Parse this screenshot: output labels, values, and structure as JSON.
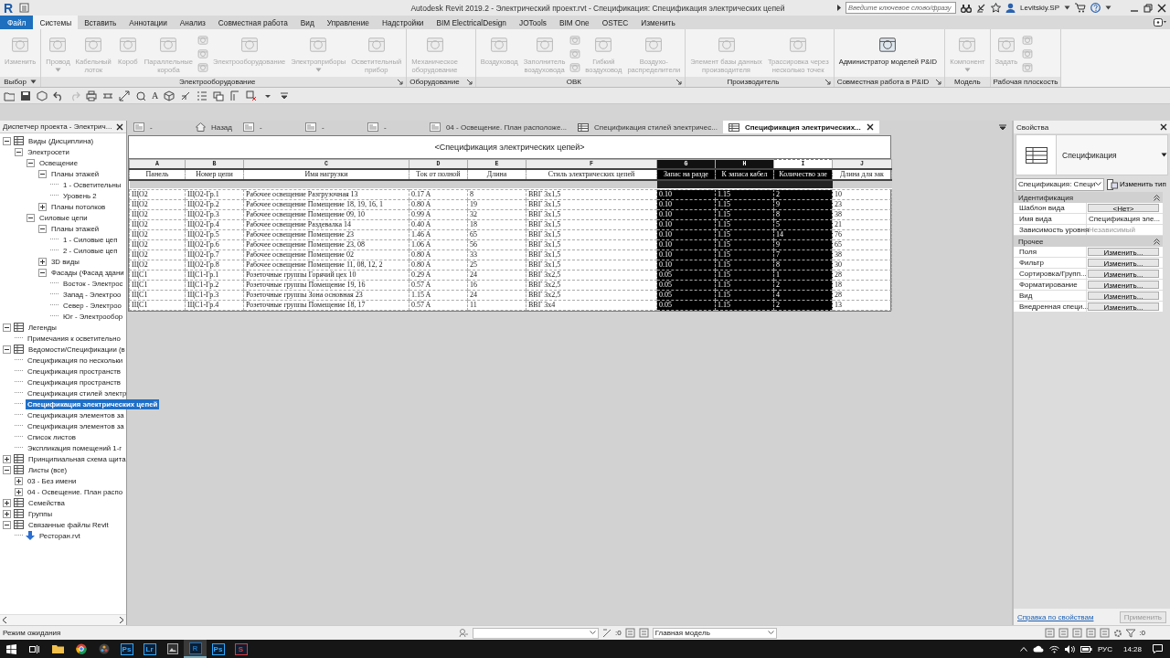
{
  "window": {
    "logo": "R",
    "title": "Autodesk Revit 2019.2 - Электрический проект.rvt - Спецификация: Спецификация электрических цепей",
    "search_placeholder": "Введите ключевое слово/фразу",
    "user": "Levitskiy.SP"
  },
  "menu_tabs": [
    {
      "label": "Файл",
      "kind": "file",
      "selected": false
    },
    {
      "label": "Системы",
      "kind": "tab",
      "selected": true
    },
    {
      "label": "Вставить",
      "kind": "tab",
      "selected": false
    },
    {
      "label": "Аннотации",
      "kind": "tab",
      "selected": false
    },
    {
      "label": "Анализ",
      "kind": "tab",
      "selected": false
    },
    {
      "label": "Совместная работа",
      "kind": "tab",
      "selected": false
    },
    {
      "label": "Вид",
      "kind": "tab",
      "selected": false
    },
    {
      "label": "Управление",
      "kind": "tab",
      "selected": false
    },
    {
      "label": "Надстройки",
      "kind": "tab",
      "selected": false
    },
    {
      "label": "BIM ElectricalDesign",
      "kind": "tab",
      "selected": false
    },
    {
      "label": "JOTools",
      "kind": "tab",
      "selected": false
    },
    {
      "label": "BIM One",
      "kind": "tab",
      "selected": false
    },
    {
      "label": "OSTEC",
      "kind": "tab",
      "selected": false
    },
    {
      "label": "Изменить",
      "kind": "tab",
      "selected": false
    }
  ],
  "ribbon": {
    "panels": [
      {
        "title": "Выбор",
        "menu": true,
        "launcher": false,
        "buttons": [
          {
            "kind": "large",
            "label": "Изменить",
            "disabled": true,
            "dropdown": false
          }
        ]
      },
      {
        "title": "Электрооборудование",
        "menu": false,
        "launcher": true,
        "buttons": [
          {
            "kind": "large",
            "label": "Провод",
            "disabled": true,
            "dropdown": true
          },
          {
            "kind": "large",
            "label": "Кабельный\nлоток",
            "disabled": true,
            "dropdown": false
          },
          {
            "kind": "large",
            "label": "Короб",
            "disabled": true,
            "dropdown": false
          },
          {
            "kind": "large",
            "label": "Параллельные\nкороба",
            "disabled": true,
            "dropdown": false
          },
          {
            "kind": "stack",
            "disabled": true
          },
          {
            "kind": "large",
            "label": "Электрооборудование",
            "disabled": true,
            "dropdown": false
          },
          {
            "kind": "large",
            "label": "Электроприборы",
            "disabled": true,
            "dropdown": true
          },
          {
            "kind": "large",
            "label": "Осветительный\nприбор",
            "disabled": true,
            "dropdown": false
          }
        ]
      },
      {
        "title": "Оборудование",
        "menu": false,
        "launcher": true,
        "buttons": [
          {
            "kind": "large",
            "label": "Механическое\nоборудование",
            "disabled": true,
            "dropdown": false
          }
        ]
      },
      {
        "title": "ОВК",
        "menu": false,
        "launcher": true,
        "buttons": [
          {
            "kind": "large",
            "label": "Воздуховод",
            "disabled": true,
            "dropdown": false
          },
          {
            "kind": "large",
            "label": "Заполнитель\nвоздуховода",
            "disabled": true,
            "dropdown": false
          },
          {
            "kind": "stack",
            "disabled": true
          },
          {
            "kind": "large",
            "label": "Гибкий\nвоздуховод",
            "disabled": true,
            "dropdown": false
          },
          {
            "kind": "large",
            "label": "Воздухо-\nраспределители",
            "disabled": true,
            "dropdown": false
          }
        ]
      },
      {
        "title": "Производитель",
        "menu": false,
        "launcher": true,
        "buttons": [
          {
            "kind": "large",
            "label": "Элемент базы данных\nпроизводителя",
            "disabled": true,
            "dropdown": false
          },
          {
            "kind": "large",
            "label": "Трассировка через\nнесколько точек",
            "disabled": true,
            "dropdown": false
          }
        ]
      },
      {
        "title": "Совместная работа в P&ID",
        "menu": false,
        "launcher": true,
        "buttons": [
          {
            "kind": "large",
            "label": "Администратор моделей P&ID",
            "disabled": false,
            "dropdown": false
          }
        ]
      },
      {
        "title": "Модель",
        "menu": false,
        "launcher": false,
        "buttons": [
          {
            "kind": "large",
            "label": "Компонент",
            "disabled": true,
            "dropdown": true
          }
        ]
      },
      {
        "title": "Рабочая плоскость",
        "menu": false,
        "launcher": false,
        "buttons": [
          {
            "kind": "large",
            "label": "Задать",
            "disabled": true,
            "dropdown": false
          },
          {
            "kind": "stack",
            "disabled": true
          }
        ]
      }
    ]
  },
  "quick_access": {
    "text_tool": "A"
  },
  "project_browser": {
    "title": "Диспетчер проекта - Электрич...",
    "tree": [
      {
        "label": "Виды (Дисциплина)",
        "kind": "category",
        "expanded": true,
        "selected": false,
        "children": [
          {
            "label": "Электросети",
            "kind": "folder",
            "expanded": true,
            "selected": false,
            "children": [
              {
                "label": "Освещение",
                "kind": "folder",
                "expanded": true,
                "selected": false,
                "children": [
                  {
                    "label": "Планы этажей",
                    "kind": "folder",
                    "expanded": true,
                    "selected": false,
                    "children": [
                      {
                        "label": "1 - Осветительны",
                        "kind": "leaf",
                        "selected": false
                      },
                      {
                        "label": "Уровень 2",
                        "kind": "leaf",
                        "selected": false
                      }
                    ]
                  },
                  {
                    "label": "Планы потолков",
                    "kind": "folder",
                    "expanded": false,
                    "selected": false
                  }
                ]
              },
              {
                "label": "Силовые цепи",
                "kind": "folder",
                "expanded": true,
                "selected": false,
                "children": [
                  {
                    "label": "Планы этажей",
                    "kind": "folder",
                    "expanded": true,
                    "selected": false,
                    "children": [
                      {
                        "label": "1 - Силовые цеп",
                        "kind": "leaf",
                        "selected": false
                      },
                      {
                        "label": "2 - Силовые цеп",
                        "kind": "leaf",
                        "selected": false
                      }
                    ]
                  },
                  {
                    "label": "3D виды",
                    "kind": "folder",
                    "expanded": false,
                    "selected": false
                  },
                  {
                    "label": "Фасады (Фасад здани",
                    "kind": "folder",
                    "expanded": true,
                    "selected": false,
                    "children": [
                      {
                        "label": "Восток - Электрос",
                        "kind": "leaf",
                        "selected": false
                      },
                      {
                        "label": "Запад - Электроо",
                        "kind": "leaf",
                        "selected": false
                      },
                      {
                        "label": "Север - Электроо",
                        "kind": "leaf",
                        "selected": false
                      },
                      {
                        "label": "Юг - Электрообор",
                        "kind": "leaf",
                        "selected": false
                      }
                    ]
                  }
                ]
              }
            ]
          }
        ]
      },
      {
        "label": "Легенды",
        "kind": "category",
        "expanded": true,
        "selected": false,
        "children": [
          {
            "label": "Примечания к осветительно",
            "kind": "leaf",
            "selected": false
          }
        ]
      },
      {
        "label": "Ведомости/Спецификации (в",
        "kind": "category",
        "expanded": true,
        "selected": false,
        "children": [
          {
            "label": "Спецификация по нескольки",
            "kind": "leaf",
            "selected": false
          },
          {
            "label": "Спецификация пространств",
            "kind": "leaf",
            "selected": false
          },
          {
            "label": "Спецификация пространств",
            "kind": "leaf",
            "selected": false
          },
          {
            "label": "Спецификация стилей электр",
            "kind": "leaf",
            "selected": false
          },
          {
            "label": "Спецификация электрических цепей",
            "kind": "leaf",
            "selected": true
          },
          {
            "label": "Спецификация элементов за",
            "kind": "leaf",
            "selected": false
          },
          {
            "label": "Спецификация элементов за",
            "kind": "leaf",
            "selected": false
          },
          {
            "label": "Список листов",
            "kind": "leaf",
            "selected": false
          },
          {
            "label": "Экспликация помещений 1-г",
            "kind": "leaf",
            "selected": false
          }
        ]
      },
      {
        "label": "Принципиальная схема щита",
        "kind": "category",
        "expanded": false,
        "selected": false
      },
      {
        "label": "Листы (все)",
        "kind": "category",
        "expanded": true,
        "selected": false,
        "children": [
          {
            "label": "03 - Без имени",
            "kind": "folder",
            "expanded": false,
            "selected": false
          },
          {
            "label": "04 - Освещение. План распо",
            "kind": "folder",
            "expanded": false,
            "selected": false
          }
        ]
      },
      {
        "label": "Семейства",
        "kind": "category",
        "expanded": false,
        "selected": false
      },
      {
        "label": "Группы",
        "kind": "category",
        "expanded": false,
        "selected": false
      },
      {
        "label": "Связанные файлы Revit",
        "kind": "category",
        "expanded": true,
        "selected": false,
        "children": [
          {
            "label": "Ресторан.rvt",
            "kind": "link",
            "selected": false
          }
        ]
      }
    ]
  },
  "view_tabs": [
    {
      "label": "-",
      "kind": "doc",
      "selected": false
    },
    {
      "label": "Назад",
      "kind": "home",
      "selected": false
    },
    {
      "label": "-",
      "kind": "doc",
      "selected": false
    },
    {
      "label": "-",
      "kind": "doc",
      "selected": false
    },
    {
      "label": "-",
      "kind": "doc",
      "selected": false
    },
    {
      "label": "04 - Освещение. План расположе...",
      "kind": "doc",
      "selected": false
    },
    {
      "label": "Спецификация стилей электричес...",
      "kind": "table",
      "selected": false
    },
    {
      "label": "Спецификация электрических...",
      "kind": "table",
      "selected": true
    }
  ],
  "schedule": {
    "title": "<Спецификация электрических цепей>",
    "columns": [
      {
        "letter": "A",
        "header": "Панель",
        "selected": false,
        "focused": false
      },
      {
        "letter": "B",
        "header": "Номер цепи",
        "selected": false,
        "focused": false
      },
      {
        "letter": "C",
        "header": "Имя нагрузки",
        "selected": false,
        "focused": false
      },
      {
        "letter": "D",
        "header": "Ток от полной",
        "selected": false,
        "focused": false
      },
      {
        "letter": "E",
        "header": "Длина",
        "selected": false,
        "focused": false
      },
      {
        "letter": "F",
        "header": "Стиль электрических цепей",
        "selected": false,
        "focused": false
      },
      {
        "letter": "G",
        "header": "Запас на разде",
        "selected": true,
        "focused": false
      },
      {
        "letter": "H",
        "header": "К запаса кабел",
        "selected": true,
        "focused": false
      },
      {
        "letter": "I",
        "header": "Количество эле",
        "selected": true,
        "focused": true
      },
      {
        "letter": "J",
        "header": "Длина для зак",
        "selected": false,
        "focused": false
      }
    ],
    "rows": [
      [
        "ЩО2",
        "ЩО2-Гр.1",
        "Рабочее освещение Разгрузочная 13",
        "0.17 A",
        "8",
        "ВВГ 3x1,5",
        "0.10",
        "1.15",
        "2",
        "10"
      ],
      [
        "ЩО2",
        "ЩО2-Гр.2",
        "Рабочее освещение Помещение 18, 19, 16, 1",
        "0.80 A",
        "19",
        "ВВГ 3x1,5",
        "0.10",
        "1.15",
        "9",
        "23"
      ],
      [
        "ЩО2",
        "ЩО2-Гр.3",
        "Рабочее освещение Помещение 09, 10",
        "0.99 A",
        "32",
        "ВВГ 3x1,5",
        "0.10",
        "1.15",
        "8",
        "38"
      ],
      [
        "ЩО2",
        "ЩО2-Гр.4",
        "Рабочее освещение Раздевалка 14",
        "0.40 A",
        "18",
        "ВВГ 3x1,5",
        "0.10",
        "1.15",
        "5",
        "21"
      ],
      [
        "ЩО2",
        "ЩО2-Гр.5",
        "Рабочее освещение Помещение 23",
        "1.46 A",
        "65",
        "ВВГ 3x1,5",
        "0.10",
        "1.15",
        "14",
        "76"
      ],
      [
        "ЩО2",
        "ЩО2-Гр.6",
        "Рабочее освещение Помещение 23, 08",
        "1.06 A",
        "56",
        "ВВГ 3x1,5",
        "0.10",
        "1.15",
        "9",
        "65"
      ],
      [
        "ЩО2",
        "ЩО2-Гр.7",
        "Рабочее освещение Помещение 02",
        "0.80 A",
        "33",
        "ВВГ 3x1,5",
        "0.10",
        "1.15",
        "7",
        "38"
      ],
      [
        "ЩО2",
        "ЩО2-Гр.8",
        "Рабочее освещение Помещение 11, 08, 12, 2",
        "0.80 A",
        "25",
        "ВВГ 3x1,5",
        "0.10",
        "1.15",
        "8",
        "30"
      ],
      [
        "ЩС1",
        "ЩС1-Гр.1",
        "Розеточные группы Горячий цех 10",
        "0.29 A",
        "24",
        "ВВГ 3x2,5",
        "0.05",
        "1.15",
        "1",
        "28"
      ],
      [
        "ЩС1",
        "ЩС1-Гр.2",
        "Розеточные группы Помещение 19, 16",
        "0.57 A",
        "16",
        "ВВГ 3x2,5",
        "0.05",
        "1.15",
        "2",
        "18"
      ],
      [
        "ЩС1",
        "ЩС1-Гр.3",
        "Розеточные группы Зона основная 23",
        "1.15 A",
        "24",
        "ВВГ 3x2,5",
        "0.05",
        "1.15",
        "4",
        "28"
      ],
      [
        "ЩС1",
        "ЩС1-Гр.4",
        "Розеточные группы Помещение 18, 17",
        "0.57 A",
        "11",
        "ВВГ 3x4",
        "0.05",
        "1.15",
        "2",
        "13"
      ]
    ]
  },
  "properties": {
    "title": "Свойства",
    "type_name": "Спецификация",
    "type_selector": "Спецификация: Специ",
    "edit_type": "Изменить тип",
    "sections": [
      {
        "title": "Идентификация",
        "expanded": true,
        "rows": [
          {
            "label": "Шаблон вида",
            "value": "<Нет>",
            "kind": "button",
            "disabled": false
          },
          {
            "label": "Имя вида",
            "value": "Спецификация эле...",
            "kind": "text",
            "disabled": false
          },
          {
            "label": "Зависимость уровня",
            "value": "Независимый",
            "kind": "text",
            "disabled": true
          }
        ]
      },
      {
        "title": "Прочее",
        "expanded": true,
        "rows": [
          {
            "label": "Поля",
            "value": "Изменить...",
            "kind": "button",
            "disabled": false
          },
          {
            "label": "Фильтр",
            "value": "Изменить...",
            "kind": "button",
            "disabled": false
          },
          {
            "label": "Сортировка/Групп...",
            "value": "Изменить...",
            "kind": "button",
            "disabled": false
          },
          {
            "label": "Форматирование",
            "value": "Изменить...",
            "kind": "button",
            "disabled": false
          },
          {
            "label": "Вид",
            "value": "Изменить...",
            "kind": "button",
            "disabled": false
          },
          {
            "label": "Внедренная специ...",
            "value": "Изменить...",
            "kind": "button",
            "disabled": false
          }
        ]
      }
    ],
    "help_link": "Справка по свойствам",
    "apply": "Применить"
  },
  "status_bar": {
    "text": "Режим ожидания",
    "select_count": ":0",
    "workset": "Главная модель",
    "filter_count": ":0"
  },
  "taskbar": {
    "apps": [
      {
        "label": "Ps",
        "color": "#31a8ff",
        "active": false
      },
      {
        "label": "Lr",
        "color": "#31a8ff",
        "active": false
      },
      {
        "label": "R",
        "color": "#1d6fb8",
        "active": true
      },
      {
        "label": "Ps",
        "color": "#31a8ff",
        "active": false
      },
      {
        "label": "S",
        "color": "#e03a3a",
        "active": false
      }
    ],
    "language": "РУС",
    "time": "14:28"
  }
}
